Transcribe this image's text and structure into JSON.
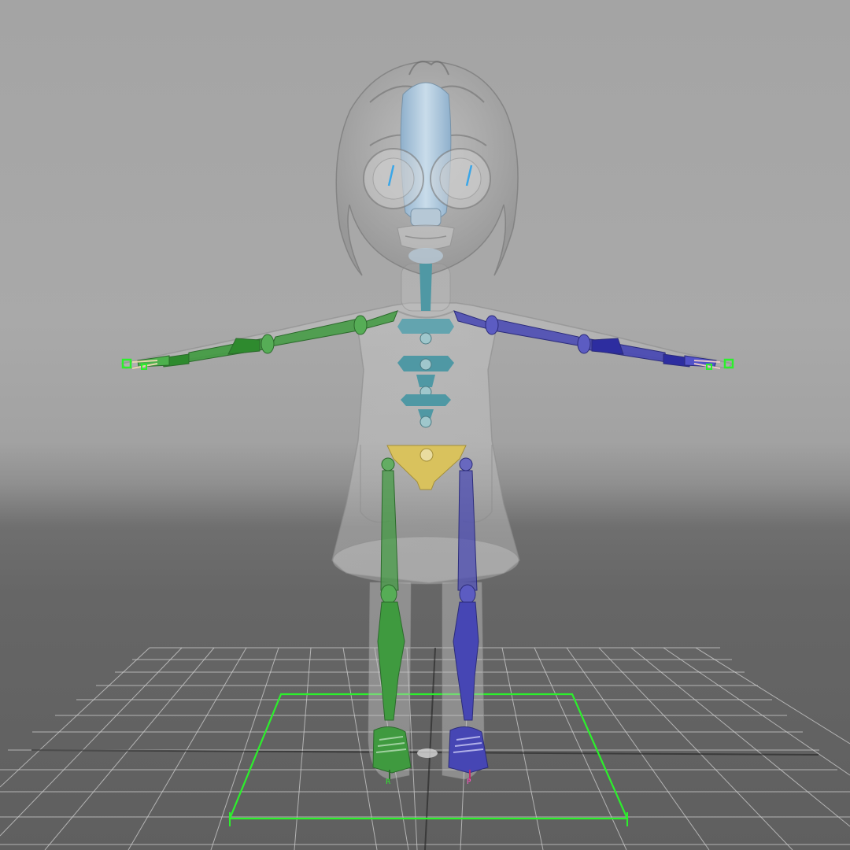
{
  "viewport": {
    "background_top": "#a6a6a6",
    "background_floor": "#606060"
  },
  "grid": {
    "visible": true,
    "color": "#cfcfcf"
  },
  "character": {
    "shell_color": "#c9c9c9",
    "face_joint_color": "#a8c4dc",
    "spine_color": "#4f98a4",
    "pelvis_color": "#d9c25d",
    "right_side_color": "#3f9a3f",
    "left_side_color": "#4646b4"
  },
  "controls": {
    "selection_color": "#2cf02c",
    "right_foot_label": "R",
    "left_foot_label": "P"
  }
}
